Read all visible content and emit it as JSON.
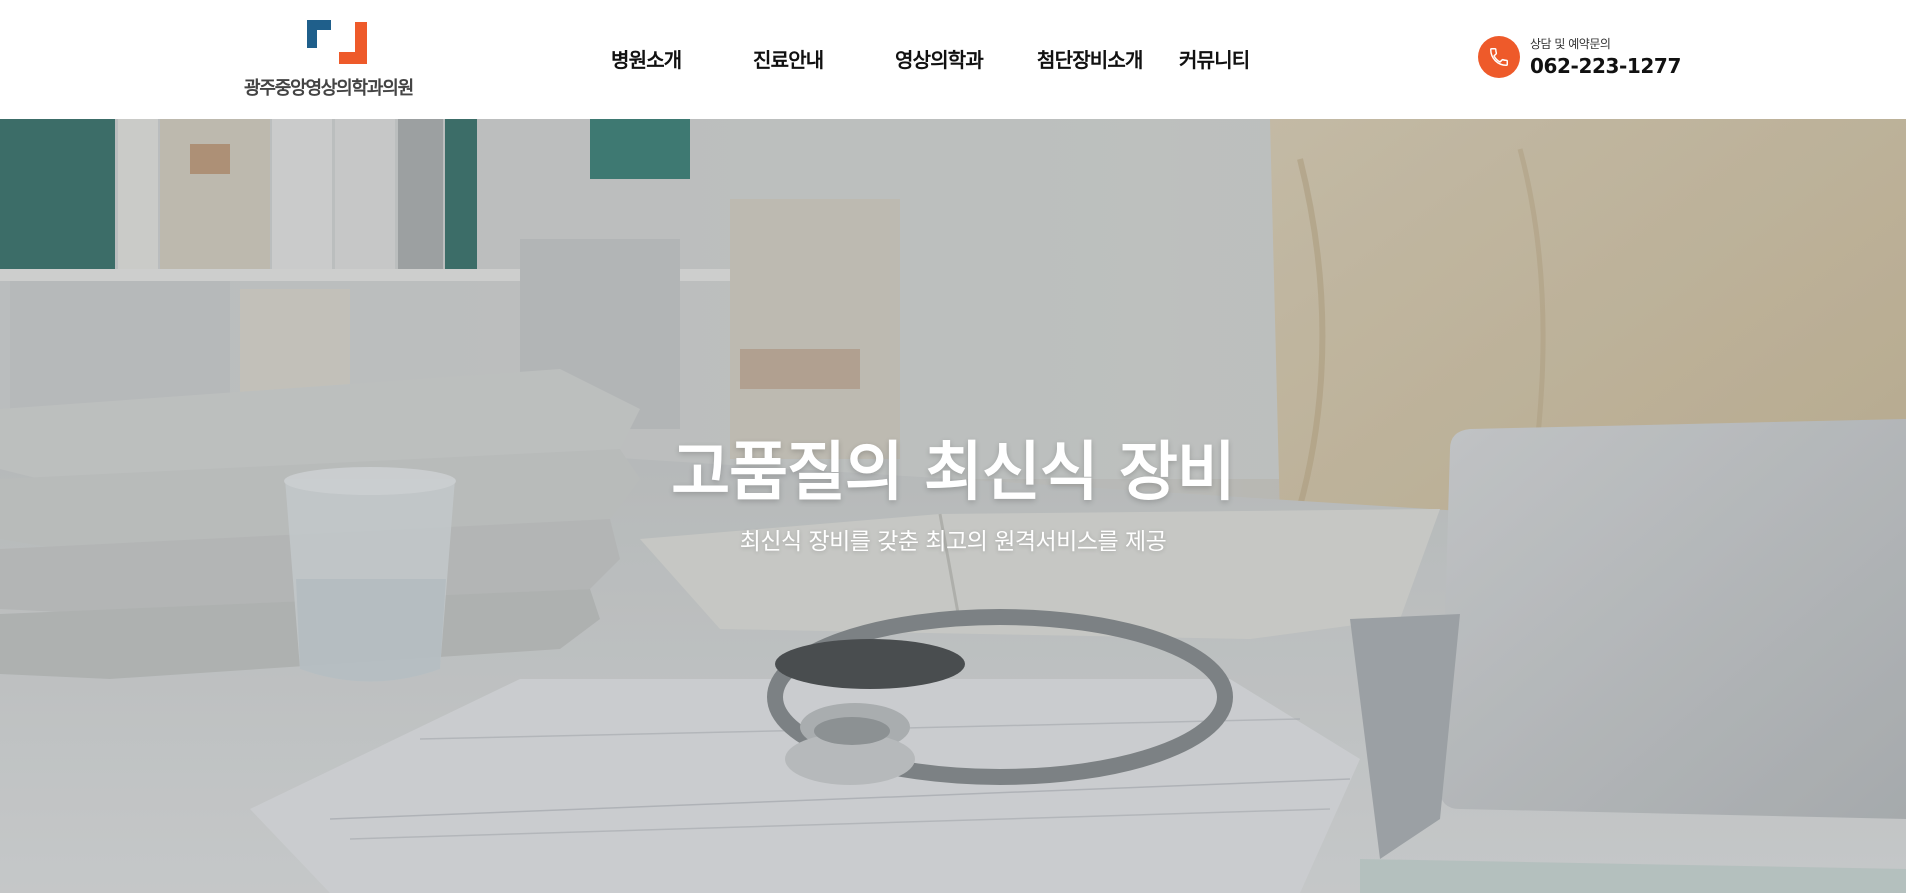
{
  "brand": {
    "name": "광주중앙영상의학과의원",
    "logo_colors": {
      "blue": "#1f5f8b",
      "orange": "#ee5a2a"
    }
  },
  "nav": {
    "items": [
      {
        "label": "병원소개"
      },
      {
        "label": "진료안내"
      },
      {
        "label": "영상의학과"
      },
      {
        "label": "첨단장비소개"
      },
      {
        "label": "커뮤니티"
      }
    ]
  },
  "contact": {
    "label": "상담 및 예약문의",
    "phone": "062-223-1277",
    "icon": "phone-icon",
    "accent": "#ee5a2a"
  },
  "hero": {
    "title": "고품질의 최신식 장비",
    "subtitle": "최신식 장비를 갖춘 최고의 원격서비스를 제공",
    "background": "doctor-desk-stethoscope-photo"
  }
}
